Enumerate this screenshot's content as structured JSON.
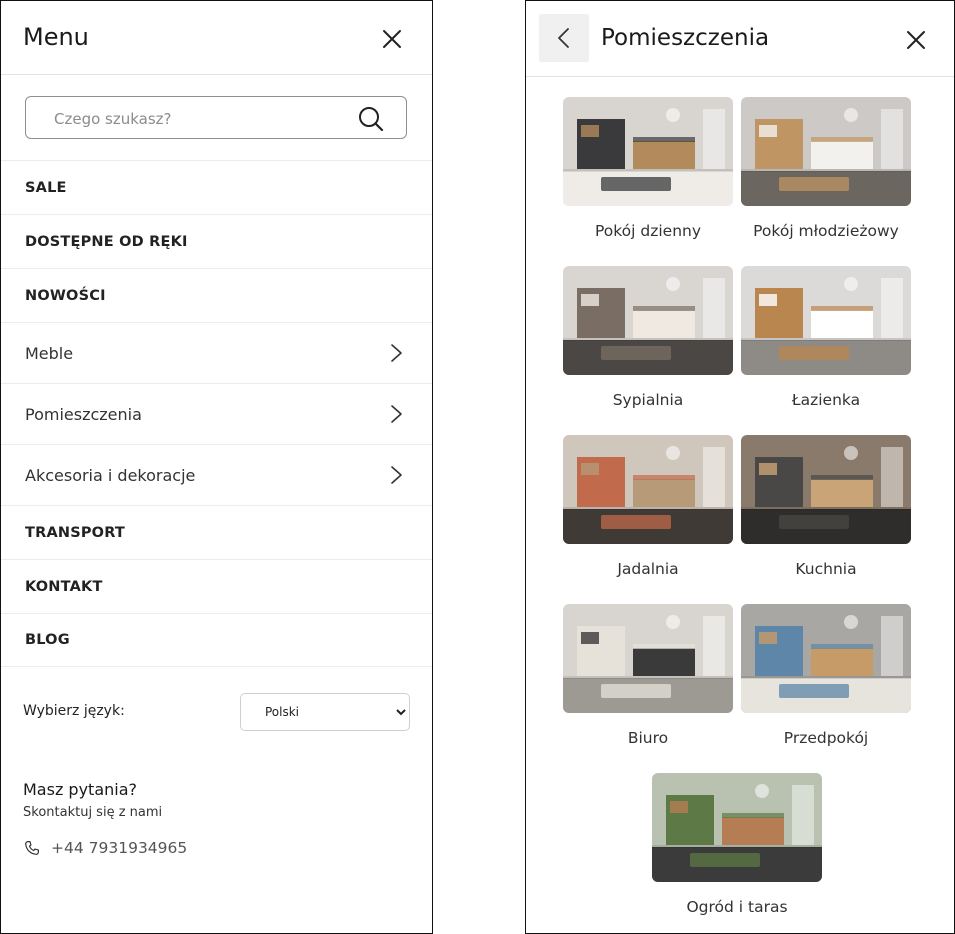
{
  "left": {
    "title": "Menu",
    "search": {
      "placeholder": "Czego szukasz?",
      "value": ""
    },
    "nav": [
      {
        "label": "SALE",
        "style": "bold",
        "has_arrow": false
      },
      {
        "label": "DOSTĘPNE OD RĘKI",
        "style": "bold",
        "has_arrow": false
      },
      {
        "label": "NOWOŚCI",
        "style": "bold",
        "has_arrow": false
      },
      {
        "label": "Meble",
        "style": "sub",
        "has_arrow": true
      },
      {
        "label": "Pomieszczenia",
        "style": "sub",
        "has_arrow": true
      },
      {
        "label": "Akcesoria i dekoracje",
        "style": "sub",
        "has_arrow": true
      },
      {
        "label": "TRANSPORT",
        "style": "bold",
        "has_arrow": false
      },
      {
        "label": "KONTAKT",
        "style": "bold",
        "has_arrow": false
      },
      {
        "label": "BLOG",
        "style": "bold",
        "has_arrow": false
      }
    ],
    "language": {
      "label": "Wybierz język:",
      "selected": "Polski"
    },
    "help": {
      "title": "Masz pytania?",
      "subtitle": "Skontaktuj się z nami",
      "phone": "+44 7931934965"
    }
  },
  "right": {
    "title": "Pomieszczenia",
    "rooms": [
      {
        "label": "Pokój dzienny",
        "palette": [
          "#d8d4cf",
          "#3a3a3c",
          "#b28a5c",
          "#efece8"
        ]
      },
      {
        "label": "Pokój młodzieżowy",
        "palette": [
          "#cdc9c6",
          "#bf9563",
          "#f3f1ee",
          "#6b6660"
        ]
      },
      {
        "label": "Sypialnia",
        "palette": [
          "#d9d6d2",
          "#7a6d63",
          "#efe9e2",
          "#4a4744"
        ]
      },
      {
        "label": "Łazienka",
        "palette": [
          "#dcdad8",
          "#b9864f",
          "#ffffff",
          "#8e8a86"
        ]
      },
      {
        "label": "Jadalnia",
        "palette": [
          "#cfc6bc",
          "#c26a4c",
          "#b79a78",
          "#3f3a35"
        ]
      },
      {
        "label": "Kuchnia",
        "palette": [
          "#8a7a6b",
          "#4a4846",
          "#c9a476",
          "#2f2d2b"
        ]
      },
      {
        "label": "Biuro",
        "palette": [
          "#d8d5d0",
          "#e6e2da",
          "#3a3a3a",
          "#9d9a94"
        ]
      },
      {
        "label": "Przedpokój",
        "palette": [
          "#a9a7a3",
          "#5d86a8",
          "#c79b67",
          "#e7e3dd"
        ]
      },
      {
        "label": "Ogród i taras",
        "palette": [
          "#b9c1b0",
          "#5d7a46",
          "#b57d53",
          "#3b3b3b"
        ]
      }
    ]
  }
}
